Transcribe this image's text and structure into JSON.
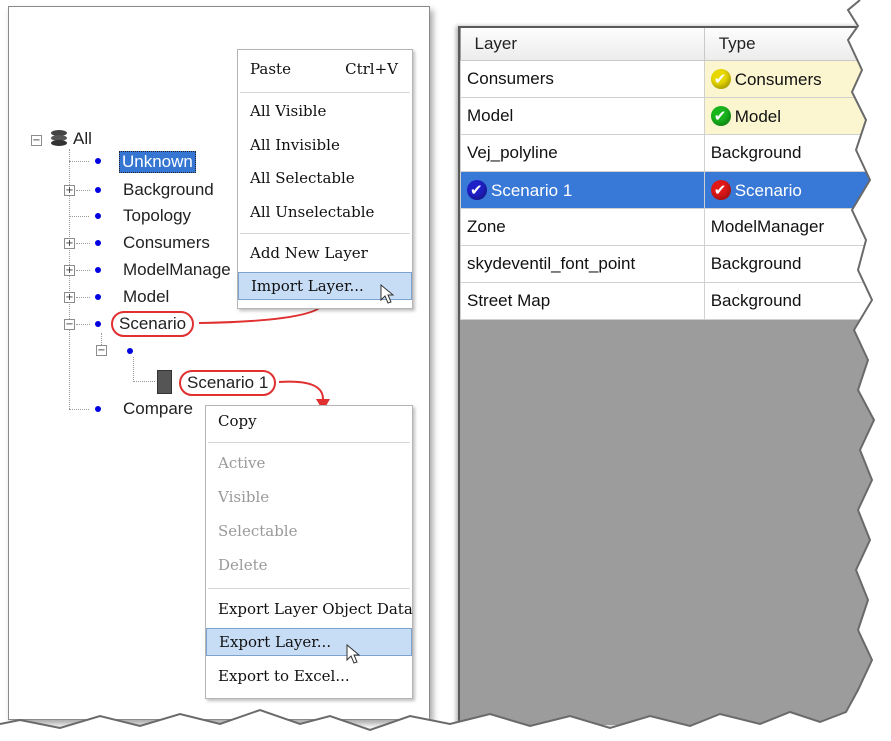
{
  "tree": {
    "root_label": "All",
    "nodes": [
      "Unknown",
      "Background",
      "Topology",
      "Consumers",
      "ModelManage",
      "Model",
      "Scenario"
    ],
    "scenario_child_label": "Scenario 1",
    "compare_label": "Compare"
  },
  "layer_menu": {
    "items": [
      "Paste",
      "All Visible",
      "All Invisible",
      "All Selectable",
      "All Unselectable",
      "Add New Layer",
      "Import Layer..."
    ],
    "paste_shortcut": "Ctrl+V"
  },
  "scenario_menu": {
    "items": [
      "Copy",
      "Active",
      "Visible",
      "Selectable",
      "Delete",
      "Export Layer Object Data",
      "Export Layer...",
      "Export to Excel..."
    ]
  },
  "grid": {
    "columns": [
      "Layer",
      "Type"
    ],
    "rows": [
      {
        "layer": "Consumers",
        "type": "Consumers",
        "icon_color": "#e8d800",
        "yellow": true
      },
      {
        "layer": "Model",
        "type": "Model",
        "icon_color": "#19b51c",
        "yellow": true
      },
      {
        "layer": "Vej_polyline",
        "type": "Background"
      },
      {
        "layer": "Scenario 1",
        "type": "Scenario",
        "icon_color": "#e01818",
        "layer_icon_color": "#2020c8",
        "selected": true
      },
      {
        "layer": "Zone",
        "type": "ModelManager"
      },
      {
        "layer": "skydeventil_font_point",
        "type": "Background"
      },
      {
        "layer": "Street Map",
        "type": "Background"
      }
    ]
  },
  "colors": {
    "selection": "#3878d6",
    "callout": "#e03030",
    "highlight": "#c7dcf5"
  }
}
